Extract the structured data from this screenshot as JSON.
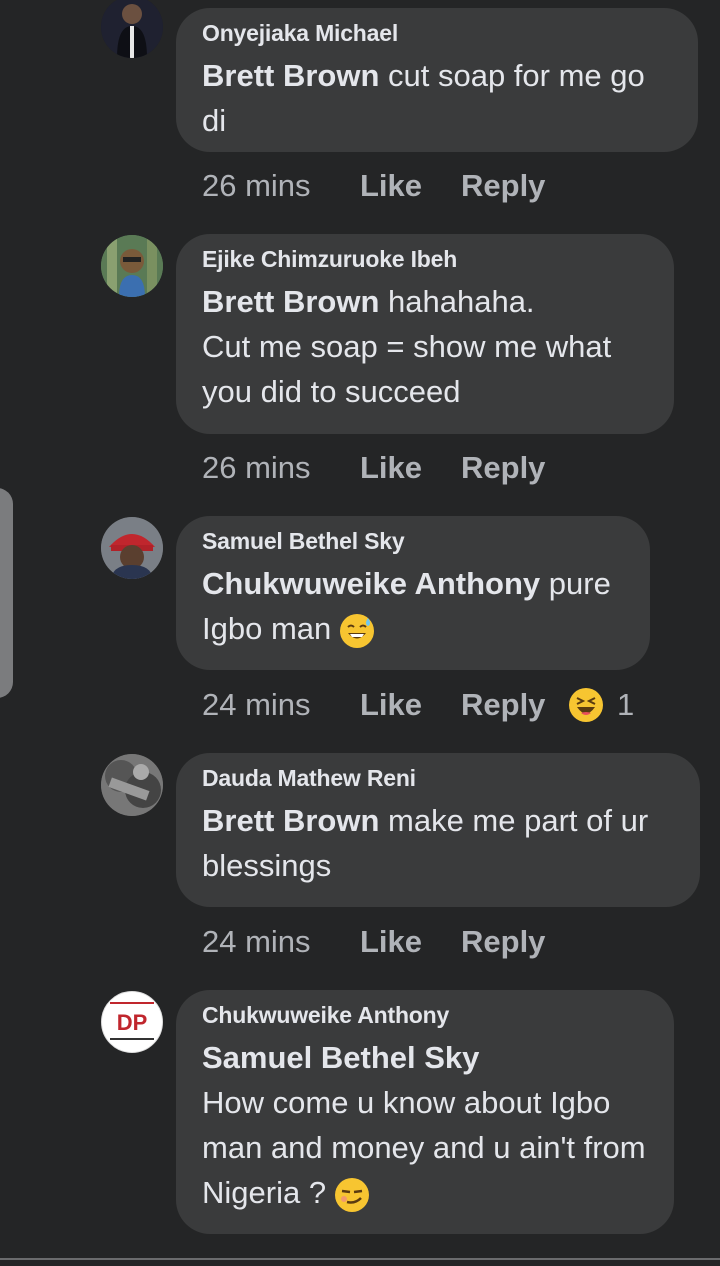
{
  "comments": [
    {
      "author": "Onyejiaka Michael",
      "mention": "Brett Brown",
      "text": " cut soap for me go di",
      "time": "26 mins",
      "like": "Like",
      "reply": "Reply"
    },
    {
      "author": "Ejike Chimzuruoke Ibeh",
      "mention": "Brett Brown",
      "text_line1": " hahahaha.",
      "text_line2": "Cut me soap = show me what you did to succeed",
      "time": "26 mins",
      "like": "Like",
      "reply": "Reply"
    },
    {
      "author": "Samuel Bethel Sky",
      "mention": "Chukwuweike Anthony",
      "text": " pure Igbo man",
      "emoji": "sweat-smile-emoji",
      "time": "24 mins",
      "like": "Like",
      "reply": "Reply",
      "reaction_icon": "haha-reaction-icon",
      "reaction_count": "1"
    },
    {
      "author": "Dauda Mathew Reni",
      "mention": "Brett Brown",
      "text": " make me part of ur blessings",
      "time": "24 mins",
      "like": "Like",
      "reply": "Reply"
    },
    {
      "author": "Chukwuweike Anthony",
      "mention": "Samuel Bethel Sky",
      "text": "How come u know about Igbo man and money and u ain't from Nigeria ?",
      "emoji": "smirk-emoji",
      "avatar_text": "DP"
    }
  ],
  "colors": {
    "background": "#242526",
    "bubble": "#3a3b3c",
    "text": "#e4e6eb",
    "meta": "#b0b3b8",
    "emoji": "#f7c531"
  }
}
